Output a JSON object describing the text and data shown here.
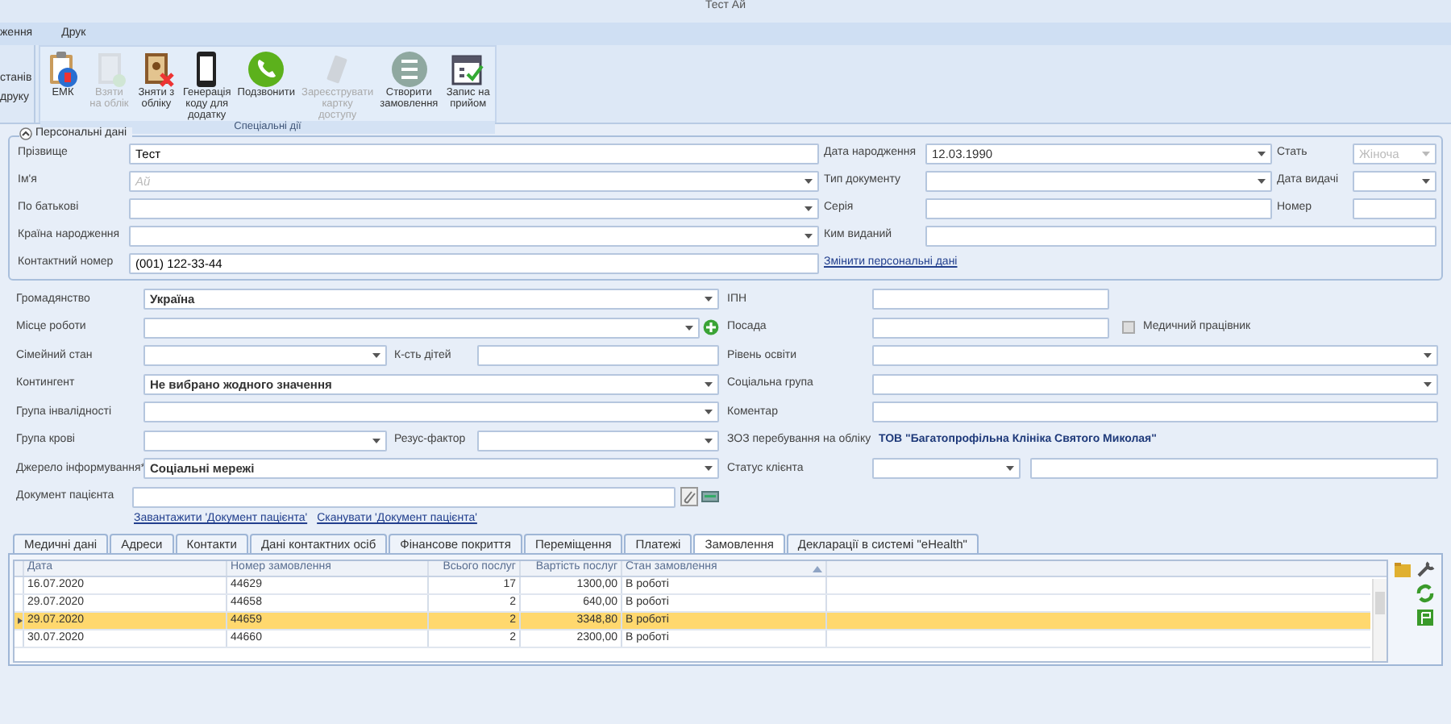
{
  "window": {
    "title": "Тест Ай"
  },
  "menu": [
    {
      "label": "ження"
    },
    {
      "label": "Друк"
    }
  ],
  "ribbon": {
    "partial_group": [
      "станів",
      "друку"
    ],
    "group": {
      "label": "Спеціальні дії",
      "buttons": [
        {
          "label": "ЕМК",
          "disabled": false
        },
        {
          "label": "Взяти на облік",
          "disabled": true
        },
        {
          "label": "Зняти з обліку",
          "disabled": false
        },
        {
          "label": "Генерація коду для додатку",
          "disabled": false
        },
        {
          "label": "Подзвонити",
          "disabled": false
        },
        {
          "label": "Зареєструвати картку доступу",
          "disabled": true
        },
        {
          "label": "Створити замовлення",
          "disabled": false
        },
        {
          "label": "Запис на прийом",
          "disabled": false
        }
      ]
    }
  },
  "personal": {
    "title": "Персональні дані",
    "expanded": true,
    "rows": [
      {
        "left": {
          "label": "Прізвище",
          "kind": "text",
          "value": "Тест"
        },
        "middle": {
          "label": "Дата народження",
          "kind": "select",
          "value": "12.03.1990"
        },
        "right": {
          "label": "Стать",
          "kind": "select",
          "value": "Жіноча",
          "disabled": true
        }
      },
      {
        "left": {
          "label": "Ім'я",
          "kind": "select",
          "placeholder": "Ай"
        },
        "middle": {
          "label": "Тип документу",
          "kind": "select"
        },
        "right": {
          "label": "Дата видачі",
          "kind": "select"
        }
      },
      {
        "left": {
          "label": "По батькові",
          "kind": "select"
        },
        "middle": {
          "label": "Серія",
          "kind": "text"
        },
        "right": {
          "label": "Номер",
          "kind": "text"
        }
      },
      {
        "left": {
          "label": "Країна народження",
          "kind": "select"
        },
        "middle": {
          "label": "Ким виданий",
          "kind": "text"
        }
      },
      {
        "left": {
          "label": "Контактний номер",
          "kind": "text",
          "value": "(001) 122-33-44"
        },
        "middle": {
          "label": "Змінити персональні дані",
          "kind": "link"
        }
      }
    ]
  },
  "details": {
    "rows": [
      {
        "left": [
          {
            "label": "Громадянство",
            "kind": "select",
            "value": "Україна"
          }
        ],
        "right": [
          {
            "label": "ІПН",
            "kind": "short_text"
          }
        ]
      },
      {
        "left": [
          {
            "label": "Місце роботи",
            "kind": "select_add"
          }
        ],
        "right": [
          {
            "label": "Посада",
            "kind": "short_text"
          },
          {
            "label": "Медичний працівник",
            "kind": "checkbox",
            "checked": false
          }
        ]
      },
      {
        "left": [
          {
            "label": "Сімейний стан",
            "kind": "select"
          },
          {
            "label": "К-сть дітей",
            "kind": "text"
          }
        ],
        "right": [
          {
            "label": "Рівень освіти",
            "kind": "select"
          }
        ]
      },
      {
        "left": [
          {
            "label": "Контингент",
            "kind": "select",
            "value": "Не вибрано жодного значення"
          }
        ],
        "right": [
          {
            "label": "Соціальна група",
            "kind": "select"
          }
        ]
      },
      {
        "left": [
          {
            "label": "Група інвалідності",
            "kind": "select"
          }
        ],
        "right": [
          {
            "label": "Коментар",
            "kind": "text"
          }
        ]
      },
      {
        "left": [
          {
            "label": "Група крові",
            "kind": "select"
          },
          {
            "label": "Резус-фактор",
            "kind": "select"
          }
        ],
        "right": [
          {
            "label": "ЗОЗ перебування на обліку",
            "kind": "info",
            "value": "ТОВ \"Багатопрофільна Клініка Святого Миколая\""
          }
        ]
      },
      {
        "left": [
          {
            "label": "Джерело інформування*",
            "kind": "select",
            "value": "Соціальні мережі"
          }
        ],
        "right": [
          {
            "label": "Статус клієнта",
            "kind": "select_pair"
          }
        ]
      },
      {
        "left": [
          {
            "label": "Документ пацієнта",
            "kind": "document"
          }
        ],
        "right": []
      }
    ],
    "links": [
      "Завантажити 'Документ пацієнта'",
      "Сканувати 'Документ пацієнта'"
    ]
  },
  "tabs": [
    {
      "label": "Медичні дані",
      "selected": false
    },
    {
      "label": "Адреси",
      "selected": false
    },
    {
      "label": "Контакти",
      "selected": false
    },
    {
      "label": "Дані контактних осіб",
      "selected": false
    },
    {
      "label": "Фінансове покриття",
      "selected": false
    },
    {
      "label": "Переміщення",
      "selected": false
    },
    {
      "label": "Платежі",
      "selected": false
    },
    {
      "label": "Замовлення",
      "selected": true
    },
    {
      "label": "Декларації в системі \"eHealth\"",
      "selected": false
    }
  ],
  "table": {
    "columns": [
      {
        "label": "Дата",
        "sorted": false
      },
      {
        "label": "Номер замовлення",
        "sorted": false
      },
      {
        "label": "Всього послуг",
        "sorted": false
      },
      {
        "label": "Вартість послуг",
        "sorted": false
      },
      {
        "label": "Стан замовлення",
        "sorted": true
      }
    ],
    "rows": [
      {
        "cells": [
          "16.07.2020",
          "44629",
          "17",
          "1300,00",
          "В роботі"
        ],
        "selected": false
      },
      {
        "cells": [
          "29.07.2020",
          "44658",
          "2",
          "640,00",
          "В роботі"
        ],
        "selected": false
      },
      {
        "cells": [
          "29.07.2020",
          "44659",
          "2",
          "3348,80",
          "В роботі"
        ],
        "selected": true
      },
      {
        "cells": [
          "30.07.2020",
          "44660",
          "2",
          "2300,00",
          "В роботі"
        ],
        "selected": false
      }
    ]
  }
}
